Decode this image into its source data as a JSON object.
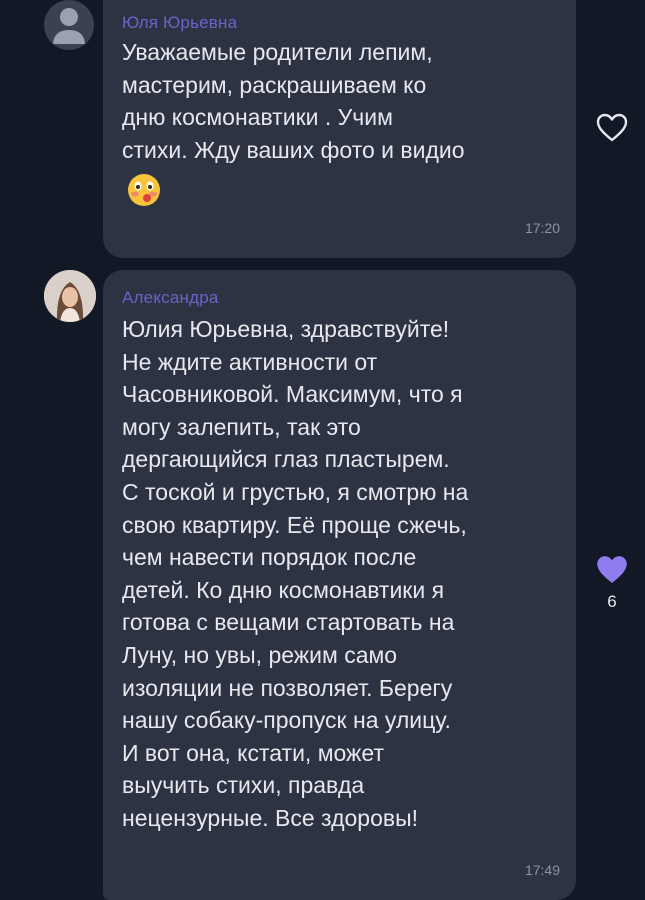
{
  "messages": [
    {
      "sender": "Юля Юрьевна",
      "lines": [
        "Уважаемые родители лепим,",
        "мастерим, раскрашиваем ко",
        "дню космонавтики . Учим",
        "стихи. Жду ваших фото и видио"
      ],
      "emoji": "face-emoji",
      "time": "17:20",
      "reaction": {
        "icon": "heart-outline-icon"
      }
    },
    {
      "sender": "Александра",
      "lines": [
        "Юлия Юрьевна, здравствуйте!",
        "Не ждите активности от",
        "Часовниковой. Максимум, что я",
        "могу залепить, так это",
        "дергающийся глаз пластырем.",
        "С тоской и грустью, я смотрю на",
        "свою квартиру. Её проще сжечь,",
        "чем навести порядок после",
        "детей. Ко дню космонавтики я",
        "готова с вещами стартовать на",
        "Луну, но увы, режим само",
        "изоляции не позволяет. Берегу",
        "нашу собаку-пропуск на улицу.",
        "И вот она, кстати, может",
        "выучить стихи, правда",
        "нецензурные. Все здоровы!"
      ],
      "time": "17:49",
      "reaction": {
        "icon": "heart-filled-icon",
        "count": "6",
        "color": "#8e7cf0"
      }
    }
  ],
  "colors": {
    "background": "#121826",
    "bubble": "#2d3343",
    "sender": "#6b63c8",
    "text": "#e6e8ee",
    "time": "#8d93a3"
  }
}
